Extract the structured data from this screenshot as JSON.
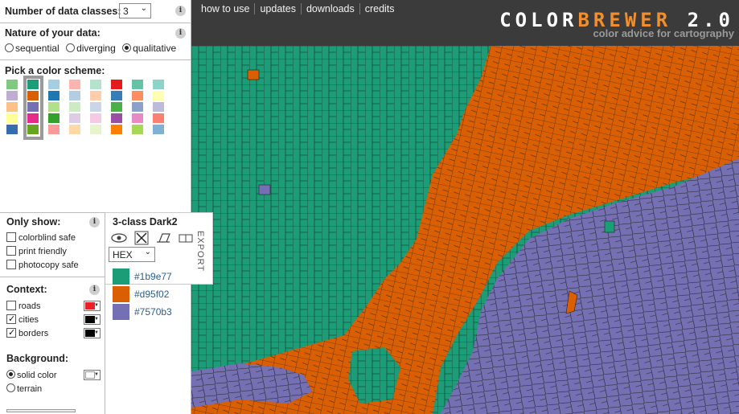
{
  "header": {
    "nav": [
      "how to use",
      "updates",
      "downloads",
      "credits"
    ],
    "brand_part1": "COLOR",
    "brand_part2": "BREWER",
    "brand_version": "2.0",
    "subtitle": "color advice for cartography"
  },
  "left": {
    "classes_label": "Number of data classes:",
    "classes_value": "3",
    "nature_label": "Nature of your data:",
    "nature_options": [
      "sequential",
      "diverging",
      "qualitative"
    ],
    "nature_selected": "qualitative",
    "pick_label": "Pick a color scheme:",
    "schemes": [
      [
        "#7fc97f",
        "#beaed4",
        "#fdc086",
        "#ffff99",
        "#386cb0"
      ],
      [
        "#1b9e77",
        "#d95f02",
        "#7570b3",
        "#e7298a",
        "#66a61e"
      ],
      [
        "#a6cee3",
        "#1f78b4",
        "#b2df8a",
        "#33a02c",
        "#fb9a99"
      ],
      [
        "#fbb4ae",
        "#b3cde3",
        "#ccebc5",
        "#decbe4",
        "#fed9a6"
      ],
      [
        "#b3e2cd",
        "#fdcdac",
        "#cbd5e8",
        "#f4cae4",
        "#e6f5c9"
      ],
      [
        "#e41a1c",
        "#377eb8",
        "#4daf4a",
        "#984ea3",
        "#ff7f00"
      ],
      [
        "#66c2a5",
        "#fc8d62",
        "#8da0cb",
        "#e78ac3",
        "#a6d854"
      ],
      [
        "#8dd3c7",
        "#ffffb3",
        "#bebada",
        "#fb8072",
        "#80b1d3"
      ]
    ],
    "selected_scheme_index": 1,
    "only_show_label": "Only show:",
    "only_show": [
      "colorblind safe",
      "print friendly",
      "photocopy safe"
    ],
    "context_label": "Context:",
    "context": [
      {
        "label": "roads",
        "checked": false,
        "color": "#e8202a"
      },
      {
        "label": "cities",
        "checked": true,
        "color": "#000000"
      },
      {
        "label": "borders",
        "checked": true,
        "color": "#000000"
      }
    ],
    "background_label": "Background:",
    "background_options": [
      "solid color",
      "terrain"
    ],
    "background_selected": "solid color",
    "background_color": "#ffffff"
  },
  "export": {
    "title": "3-class Dark2",
    "tab_label": "EXPORT",
    "format_value": "HEX",
    "colors": [
      {
        "hex": "#1b9e77",
        "label": "#1b9e77"
      },
      {
        "hex": "#d95f02",
        "label": "#d95f02"
      },
      {
        "hex": "#7570b3",
        "label": "#7570b3"
      }
    ],
    "icons": [
      "eye-icon",
      "crossed-eye-icon",
      "print-icon",
      "copy-icon"
    ]
  },
  "map": {
    "colors": {
      "green": "#1b9e77",
      "orange": "#d95f02",
      "purple": "#7570b3"
    }
  }
}
